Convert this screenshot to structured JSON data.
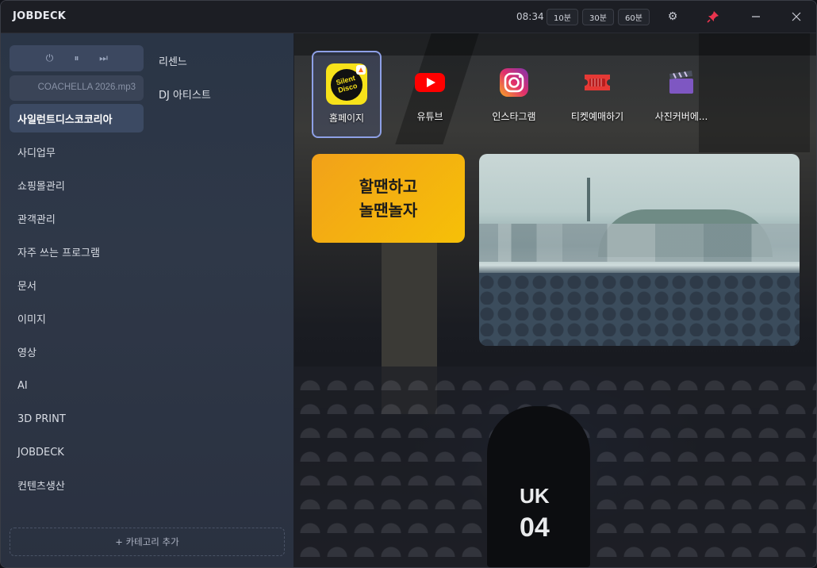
{
  "app": {
    "title": "JOBDECK"
  },
  "titlebar": {
    "clock": "08:34",
    "timers": [
      "10분",
      "30분",
      "60분"
    ],
    "icons": [
      "gear-icon",
      "pin-icon",
      "minimize-icon",
      "close-icon"
    ]
  },
  "player": {
    "track": "COACHELLA 2026.mp3",
    "controls": {
      "power": "⏻",
      "pause": "⏸",
      "next": "⏭"
    }
  },
  "sidebar": {
    "categories": [
      {
        "label": "사일런트디스코코리아",
        "active": true
      },
      {
        "label": "사디업무"
      },
      {
        "label": "쇼핑몰관리"
      },
      {
        "label": "관객관리"
      },
      {
        "label": "자주 쓰는 프로그램"
      },
      {
        "label": "문서"
      },
      {
        "label": "이미지"
      },
      {
        "label": "영상"
      },
      {
        "label": "AI"
      },
      {
        "label": "3D PRINT"
      },
      {
        "label": "JOBDECK"
      },
      {
        "label": "컨텐츠생산"
      }
    ],
    "subcategories": [
      "리센느",
      "DJ 아티스트"
    ],
    "add_category": "+ 카테고리 추가"
  },
  "shortcuts": [
    {
      "label": "홈페이지",
      "icon": "silent-disco-logo-icon",
      "selected": true,
      "logo_text": "Silent Disco"
    },
    {
      "label": "유튜브",
      "icon": "youtube-icon"
    },
    {
      "label": "인스타그램",
      "icon": "instagram-icon"
    },
    {
      "label": "티켓예매하기",
      "icon": "ticket-icon"
    },
    {
      "label": "사진커버에...",
      "icon": "clapperboard-icon"
    }
  ],
  "promo": {
    "line1": "할땐하고",
    "line2": "놀땐놀자"
  },
  "background": {
    "shirt_text_1": "UK",
    "shirt_text_2": "04"
  },
  "colors": {
    "accent": "#8ea0e6",
    "promo": "#f6b70f",
    "youtube": "#ff0000",
    "instagram": "#e1306c"
  }
}
